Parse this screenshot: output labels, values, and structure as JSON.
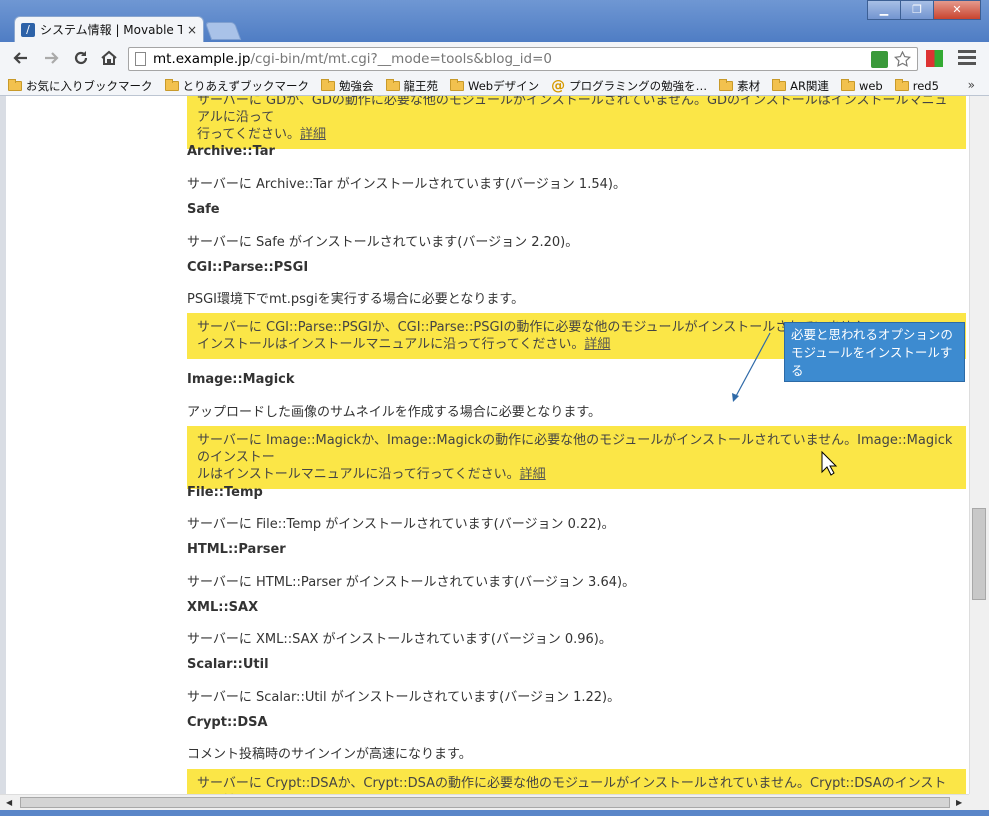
{
  "browser": {
    "tab_title": "システム情報 | Movable Typ",
    "tab_close": "×",
    "url_host": "mt.example.jp",
    "url_path": "/cgi-bin/mt/mt.cgi?__mode=tools&blog_id=0",
    "window_buttons": [
      "▁",
      "❐",
      "✕"
    ]
  },
  "bookmarks": [
    {
      "label": "お気に入りブックマーク",
      "icon": "folder-icon"
    },
    {
      "label": "とりあえずブックマーク",
      "icon": "folder-icon"
    },
    {
      "label": "勉強会",
      "icon": "folder-icon"
    },
    {
      "label": "龍王苑",
      "icon": "folder-icon"
    },
    {
      "label": "Webデザイン",
      "icon": "folder-icon"
    },
    {
      "label": "プログラミングの勉強を…",
      "icon": "at-icon"
    },
    {
      "label": "素材",
      "icon": "folder-icon"
    },
    {
      "label": "AR関連",
      "icon": "folder-icon"
    },
    {
      "label": "web",
      "icon": "folder-icon"
    },
    {
      "label": "red5",
      "icon": "folder-icon"
    }
  ],
  "bookmarks_more": "»",
  "content": {
    "top_alert_line1": "サーバーに GDか、GDの動作に必要な他のモジュールがインストールされていません。GDのインストールはインストールマニュアルに沿って",
    "top_alert_line2": "行ってください。",
    "detail_label": "詳細",
    "modules": [
      {
        "name": "Archive::Tar",
        "desc": "サーバーに Archive::Tar がインストールされています(バージョン 1.54)。"
      },
      {
        "name": "Safe",
        "desc": "サーバーに Safe がインストールされています(バージョン 2.20)。"
      },
      {
        "name": "CGI::Parse::PSGI",
        "desc": "PSGI環境下でmt.psgiを実行する場合に必要となります。",
        "alert_line1": "サーバーに CGI::Parse::PSGIか、CGI::Parse::PSGIの動作に必要な他のモジュールがインストールされていません。",
        "alert_line2": "インストールはインストールマニュアルに沿って行ってください。"
      },
      {
        "name": "Image::Magick",
        "desc": "アップロードした画像のサムネイルを作成する場合に必要となります。",
        "alert_line1": "サーバーに Image::Magickか、Image::Magickの動作に必要な他のモジュールがインストールされていません。Image::Magickのインストー",
        "alert_line2": "ルはインストールマニュアルに沿って行ってください。"
      },
      {
        "name": "File::Temp",
        "desc": "サーバーに File::Temp がインストールされています(バージョン 0.22)。"
      },
      {
        "name": "HTML::Parser",
        "desc": "サーバーに HTML::Parser がインストールされています(バージョン 3.64)。"
      },
      {
        "name": "XML::SAX",
        "desc": "サーバーに XML::SAX がインストールされています(バージョン 0.96)。"
      },
      {
        "name": "Scalar::Util",
        "desc": "サーバーに Scalar::Util がインストールされています(バージョン 1.22)。"
      },
      {
        "name": "Crypt::DSA",
        "desc": "コメント投稿時のサインインが高速になります。",
        "alert_line1": "サーバーに Crypt::DSAか、Crypt::DSAの動作に必要な他のモジュールがインストールされていません。Crypt::DSAのインストールはインス"
      }
    ]
  },
  "annotation": {
    "text": "必要と思われるオプションのモジュールをインストールする"
  },
  "colors": {
    "alert_bg": "#fbe647",
    "callout_bg": "#3d8bd0",
    "chrome_frame": "#5a86c8"
  }
}
